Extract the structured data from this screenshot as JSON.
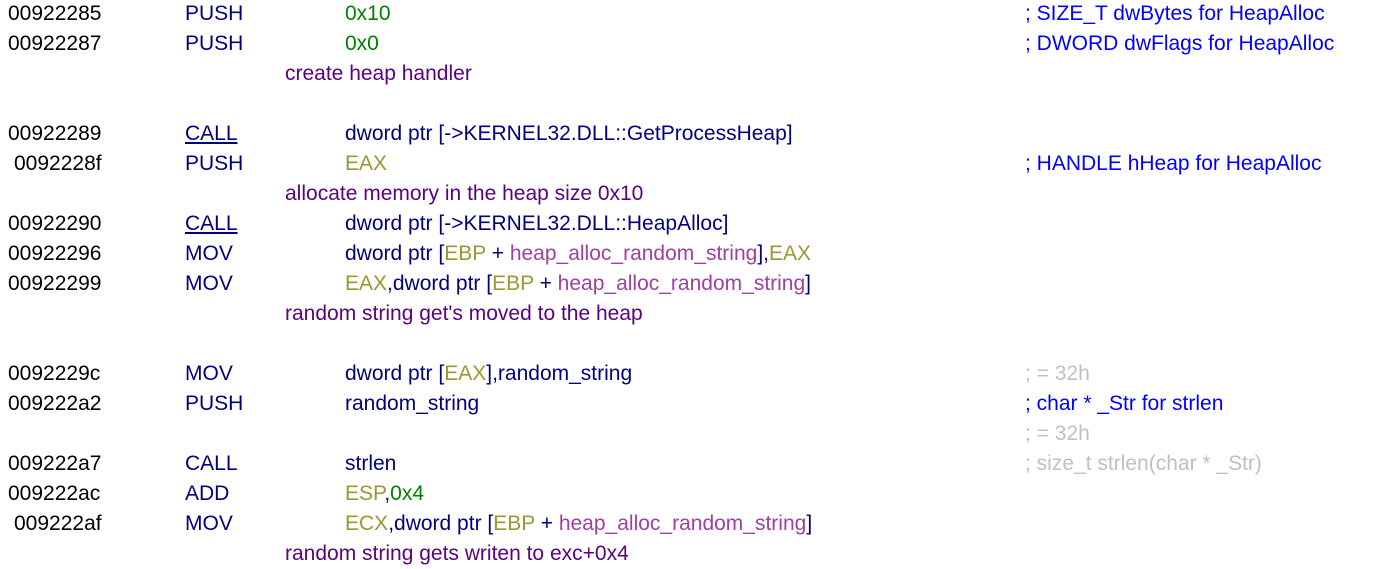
{
  "colors": {
    "address": "#000000",
    "mnemonic": "#000080",
    "operand_text": "#000080",
    "number": "#008000",
    "register": "#999933",
    "variable": "#a040a0",
    "comment": "#0000ff",
    "auto_comment": "#c0c0c0",
    "plate_comment": "#5a0080"
  },
  "lines": [
    {
      "kind": "instr",
      "addr": "00922285",
      "mnemonic": "PUSH",
      "operands": [
        {
          "t": "num",
          "v": "0x10"
        }
      ],
      "comment": "; SIZE_T dwBytes for HeapAlloc",
      "comment_style": "blue"
    },
    {
      "kind": "instr",
      "addr": "00922287",
      "mnemonic": "PUSH",
      "operands": [
        {
          "t": "num",
          "v": "0x0"
        }
      ],
      "comment": "; DWORD dwFlags for HeapAlloc",
      "comment_style": "blue"
    },
    {
      "kind": "plate",
      "text": "create heap handler"
    },
    {
      "kind": "blank"
    },
    {
      "kind": "instr",
      "addr": "00922289",
      "mnemonic": "CALL",
      "call": true,
      "operands": [
        {
          "t": "txt",
          "v": "dword ptr [->KERNEL32.DLL::GetProcessHeap]"
        }
      ]
    },
    {
      "kind": "instr",
      "addr": "0092228f",
      "indent": true,
      "mnemonic": "PUSH",
      "operands": [
        {
          "t": "reg",
          "v": "EAX"
        }
      ],
      "comment": "; HANDLE hHeap for HeapAlloc",
      "comment_style": "blue"
    },
    {
      "kind": "plate",
      "text": "allocate memory in the heap size 0x10"
    },
    {
      "kind": "instr",
      "addr": "00922290",
      "mnemonic": "CALL",
      "call": true,
      "operands": [
        {
          "t": "txt",
          "v": "dword ptr [->KERNEL32.DLL::HeapAlloc]"
        }
      ]
    },
    {
      "kind": "instr",
      "addr": "00922296",
      "mnemonic": "MOV",
      "operands": [
        {
          "t": "txt",
          "v": "dword ptr ["
        },
        {
          "t": "reg",
          "v": "EBP"
        },
        {
          "t": "txt",
          "v": " + "
        },
        {
          "t": "var",
          "v": "heap_alloc_random_string"
        },
        {
          "t": "txt",
          "v": "],"
        },
        {
          "t": "reg",
          "v": "EAX"
        }
      ]
    },
    {
      "kind": "instr",
      "addr": "00922299",
      "mnemonic": "MOV",
      "operands": [
        {
          "t": "reg",
          "v": "EAX"
        },
        {
          "t": "txt",
          "v": ",dword ptr ["
        },
        {
          "t": "reg",
          "v": "EBP"
        },
        {
          "t": "txt",
          "v": " + "
        },
        {
          "t": "var",
          "v": "heap_alloc_random_string"
        },
        {
          "t": "txt",
          "v": "]"
        }
      ]
    },
    {
      "kind": "plate",
      "text": "random string get's moved to the heap"
    },
    {
      "kind": "blank"
    },
    {
      "kind": "instr",
      "addr": "0092229c",
      "mnemonic": "MOV",
      "operands": [
        {
          "t": "txt",
          "v": "dword ptr ["
        },
        {
          "t": "reg",
          "v": "EAX"
        },
        {
          "t": "txt",
          "v": "],random_string"
        }
      ],
      "comment": "; = 32h",
      "comment_style": "gray"
    },
    {
      "kind": "instr",
      "addr": "009222a2",
      "mnemonic": "PUSH",
      "operands": [
        {
          "t": "txt",
          "v": "random_string"
        }
      ],
      "comment": "; char * _Str for strlen",
      "comment_style": "blue"
    },
    {
      "kind": "comment",
      "comment": "; = 32h",
      "comment_style": "gray"
    },
    {
      "kind": "instr",
      "addr": "009222a7",
      "mnemonic": "CALL",
      "operands": [
        {
          "t": "txt",
          "v": "strlen"
        }
      ],
      "comment": "; size_t strlen(char * _Str)",
      "comment_style": "gray"
    },
    {
      "kind": "instr",
      "addr": "009222ac",
      "mnemonic": "ADD",
      "operands": [
        {
          "t": "reg",
          "v": "ESP"
        },
        {
          "t": "txt",
          "v": ","
        },
        {
          "t": "num",
          "v": "0x4"
        }
      ]
    },
    {
      "kind": "instr",
      "addr": "009222af",
      "indent": true,
      "mnemonic": "MOV",
      "operands": [
        {
          "t": "reg",
          "v": "ECX"
        },
        {
          "t": "txt",
          "v": ",dword ptr ["
        },
        {
          "t": "reg",
          "v": "EBP"
        },
        {
          "t": "txt",
          "v": " + "
        },
        {
          "t": "var",
          "v": "heap_alloc_random_string"
        },
        {
          "t": "txt",
          "v": "]"
        }
      ]
    },
    {
      "kind": "plate",
      "text": "random string gets writen to exc+0x4"
    }
  ]
}
